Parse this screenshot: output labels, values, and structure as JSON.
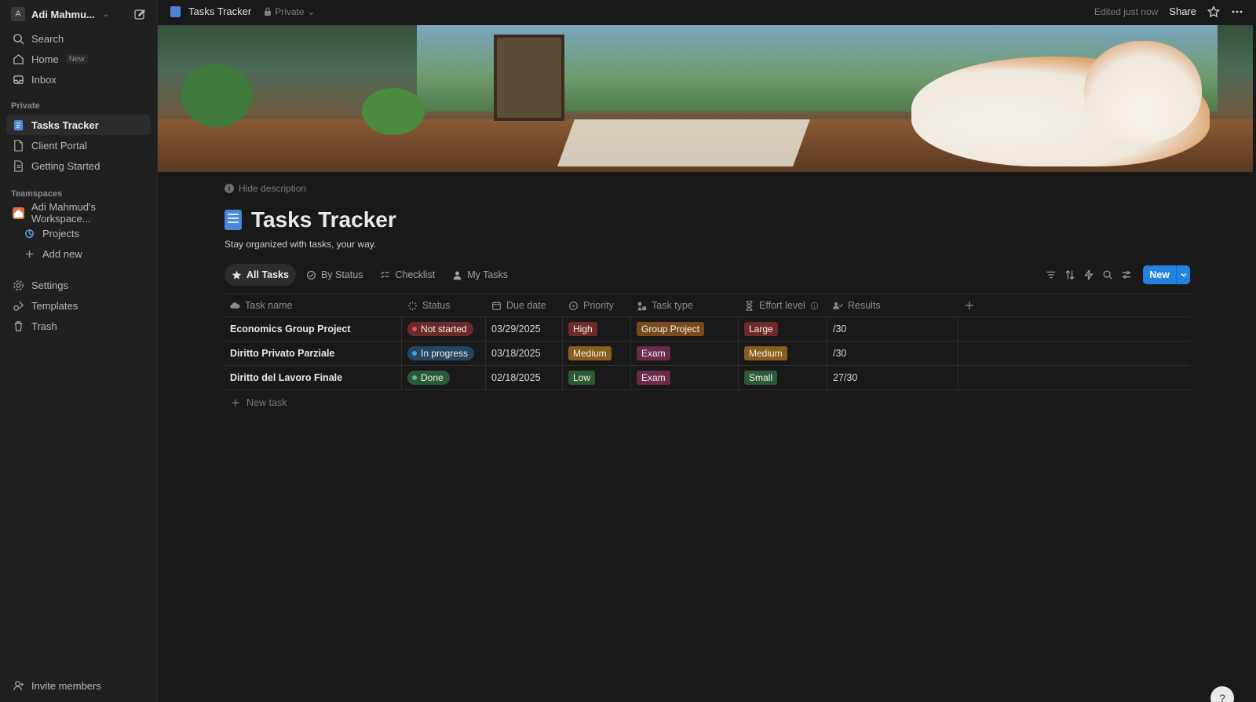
{
  "sidebar": {
    "workspace_initial": "A",
    "workspace_name": "Adi Mahmu...",
    "top_items": [
      {
        "label": "Search",
        "icon": "search-icon"
      },
      {
        "label": "Home",
        "icon": "home-icon",
        "badge": "New"
      },
      {
        "label": "Inbox",
        "icon": "inbox-icon"
      }
    ],
    "private_label": "Private",
    "private_items": [
      {
        "label": "Tasks Tracker",
        "icon": "tasks-doc-icon"
      },
      {
        "label": "Client Portal",
        "icon": "page-icon"
      },
      {
        "label": "Getting Started",
        "icon": "page-icon"
      }
    ],
    "teamspaces_label": "Teamspaces",
    "teamspace_name": "Adi Mahmud's Workspace...",
    "teamspace_items": [
      {
        "label": "Projects",
        "icon": "projects-icon"
      },
      {
        "label": "Add new",
        "icon": "plus-icon"
      }
    ],
    "bottom_items": [
      {
        "label": "Settings",
        "icon": "gear-icon"
      },
      {
        "label": "Templates",
        "icon": "templates-icon"
      },
      {
        "label": "Trash",
        "icon": "trash-icon"
      }
    ],
    "invite_label": "Invite members"
  },
  "topbar": {
    "title": "Tasks Tracker",
    "privacy": "Private",
    "edited": "Edited just now",
    "share": "Share"
  },
  "page": {
    "hide_description": "Hide description",
    "title": "Tasks Tracker",
    "subtitle": "Stay organized with tasks, your way."
  },
  "views": [
    {
      "label": "All Tasks",
      "icon": "star-icon"
    },
    {
      "label": "By Status",
      "icon": "status-icon"
    },
    {
      "label": "Checklist",
      "icon": "checklist-icon"
    },
    {
      "label": "My Tasks",
      "icon": "person-icon"
    }
  ],
  "toolbar": {
    "new_label": "New"
  },
  "table": {
    "columns": [
      "Task name",
      "Status",
      "Due date",
      "Priority",
      "Task type",
      "Effort level",
      "Results"
    ],
    "rows": [
      {
        "name": "Economics Group Project",
        "status": "Not started",
        "due": "03/29/2025",
        "priority": "High",
        "type": "Group Project",
        "effort": "Large",
        "results": "/30"
      },
      {
        "name": "Diritto Privato Parziale",
        "status": "In progress",
        "due": "03/18/2025",
        "priority": "Medium",
        "type": "Exam",
        "effort": "Medium",
        "results": "/30"
      },
      {
        "name": "Diritto del Lavoro Finale",
        "status": "Done",
        "due": "02/18/2025",
        "priority": "Low",
        "type": "Exam",
        "effort": "Small",
        "results": "27/30"
      }
    ],
    "new_task": "New task"
  },
  "colors": {
    "accent": "#2383e2",
    "not_started": "#6b2b2b",
    "in_progress": "#254660",
    "done": "#2a5a3a",
    "high": "#6e2a2a",
    "medium": "#8a5e1c",
    "low": "#2b5a35",
    "group_project": "#7a4a1c",
    "exam": "#6b2a4a"
  },
  "help_glyph": "?"
}
